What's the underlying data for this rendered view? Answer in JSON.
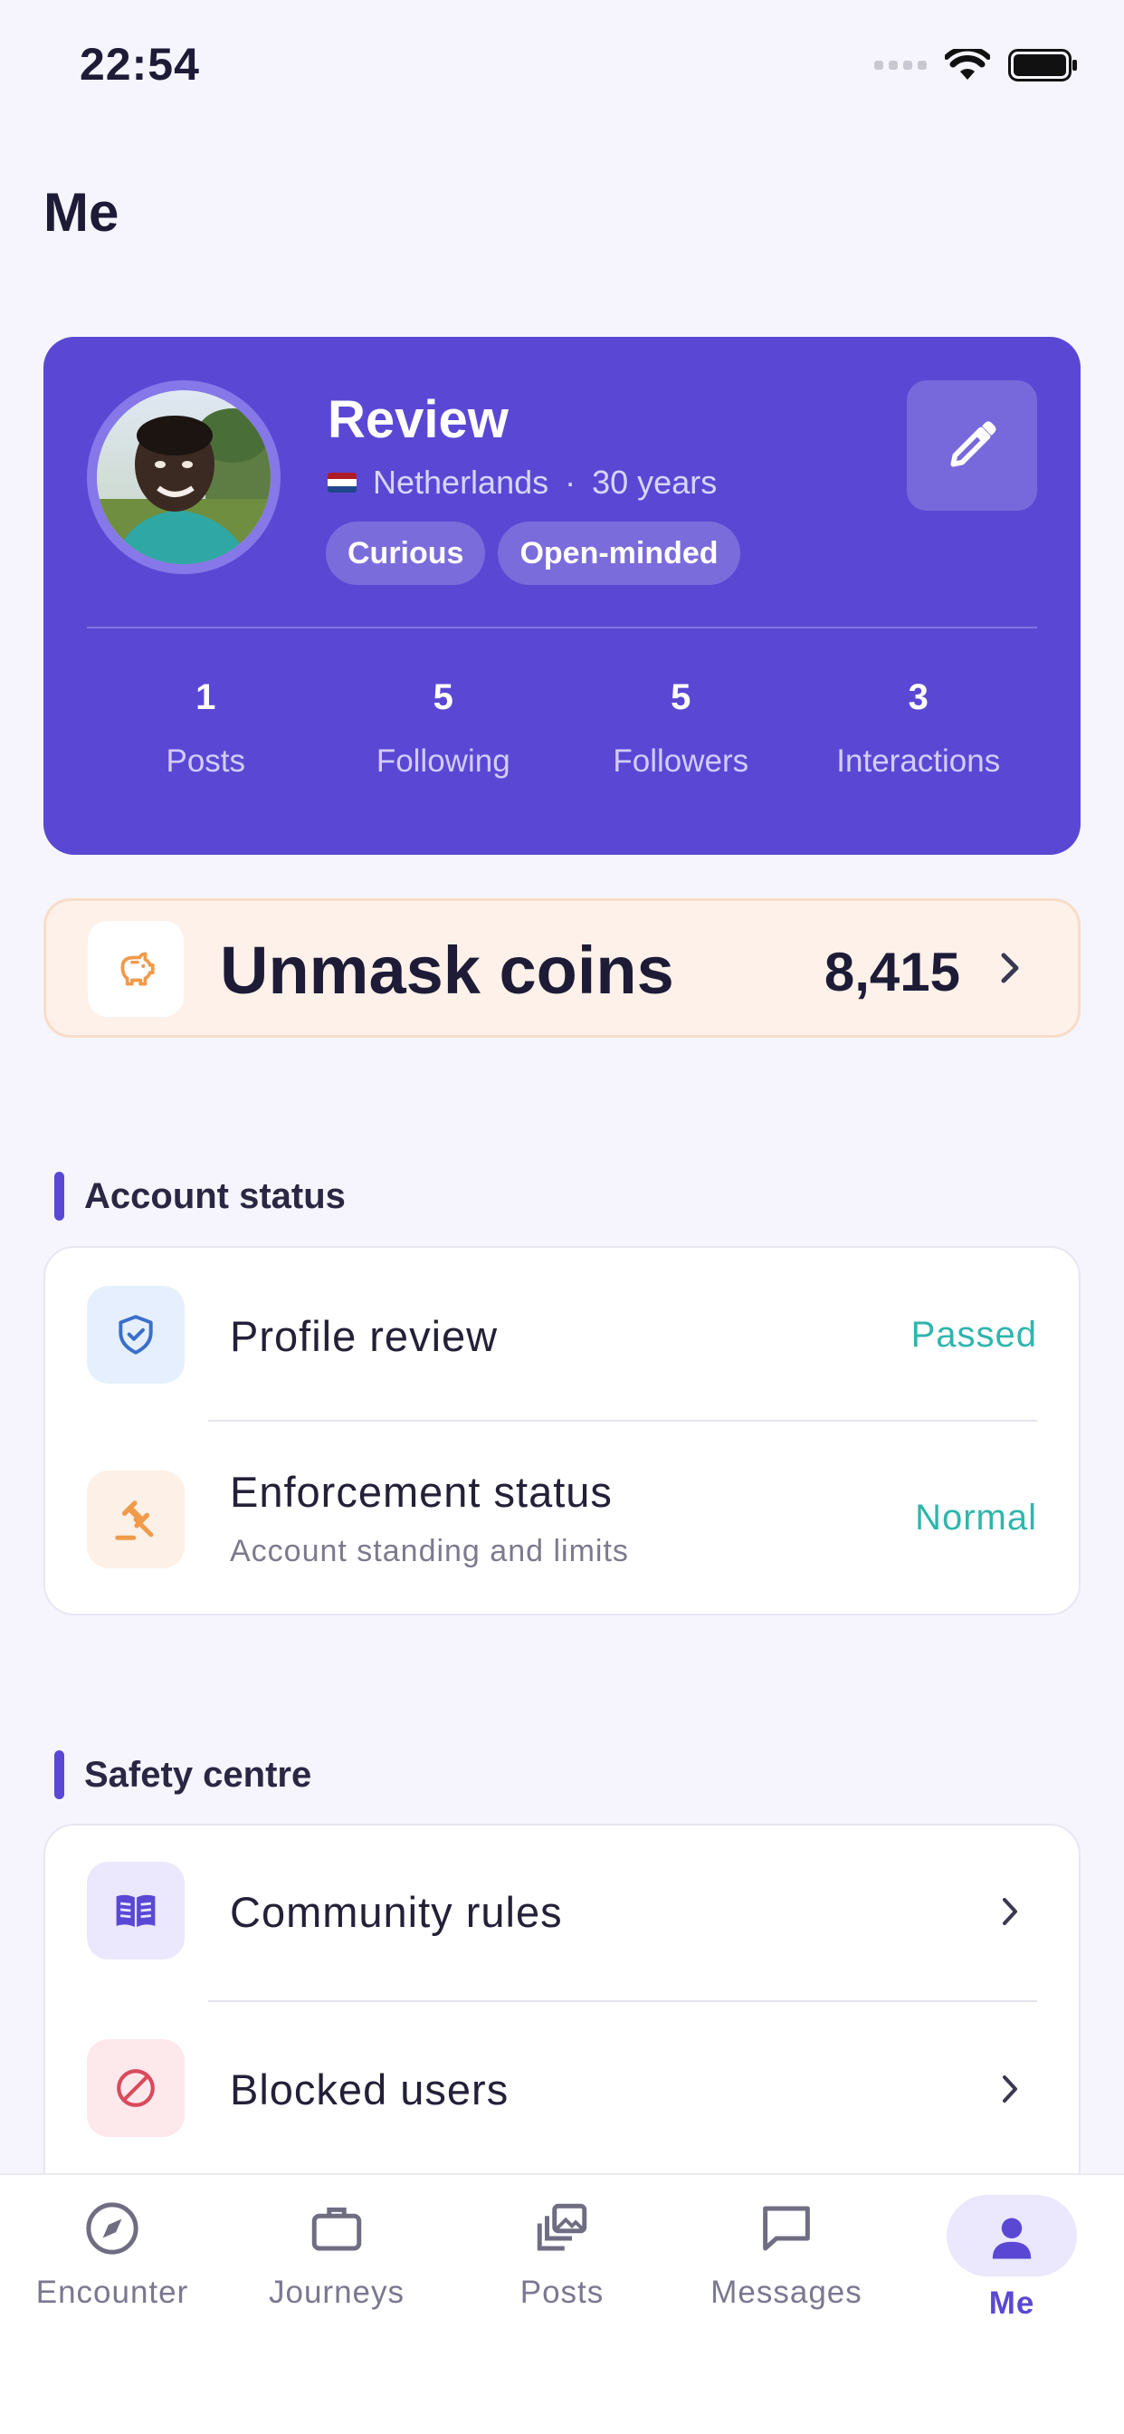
{
  "status_bar": {
    "time": "22:54"
  },
  "page_title": "Me",
  "profile": {
    "name": "Review",
    "country": "Netherlands",
    "separator": "·",
    "age": "30 years",
    "tags": [
      "Curious",
      "Open-minded"
    ],
    "stats": [
      {
        "value": "1",
        "label": "Posts"
      },
      {
        "value": "5",
        "label": "Following"
      },
      {
        "value": "5",
        "label": "Followers"
      },
      {
        "value": "3",
        "label": "Interactions"
      }
    ]
  },
  "coins": {
    "title": "Unmask coins",
    "value": "8,415"
  },
  "account_status": {
    "title": "Account status",
    "rows": [
      {
        "title": "Profile review",
        "subtitle": "",
        "status": "Passed"
      },
      {
        "title": "Enforcement status",
        "subtitle": "Account standing and limits",
        "status": "Normal"
      }
    ]
  },
  "safety_centre": {
    "title": "Safety centre",
    "rows": [
      {
        "title": "Community rules"
      },
      {
        "title": "Blocked users"
      }
    ]
  },
  "tabbar": {
    "tabs": [
      {
        "label": "Encounter",
        "icon": "compass-icon"
      },
      {
        "label": "Journeys",
        "icon": "briefcase-icon"
      },
      {
        "label": "Posts",
        "icon": "photo-stack-icon"
      },
      {
        "label": "Messages",
        "icon": "chat-bubble-icon"
      },
      {
        "label": "Me",
        "icon": "person-icon",
        "active": true
      }
    ]
  },
  "colors": {
    "primary": "#5a48d4",
    "status_ok": "#2fb6ad",
    "coins_bg": "#fdf1ea",
    "coin_icon": "#f09a4a",
    "danger": "#d94a5c"
  }
}
